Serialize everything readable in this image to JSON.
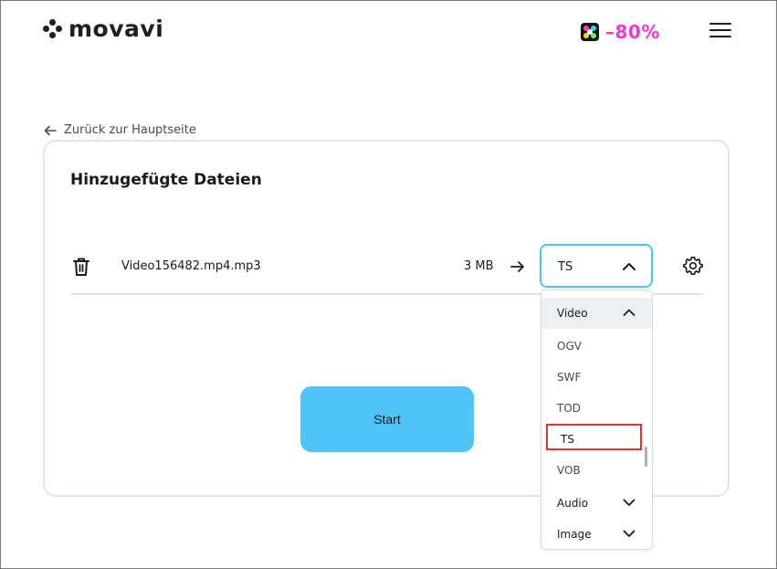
{
  "header": {
    "logo_text": "movavi",
    "promo_text": "–80%",
    "menu_icon": "hamburger-menu-icon"
  },
  "nav": {
    "back_label": "Zurück zur Hauptseite",
    "back_icon": "arrow-left-icon"
  },
  "card": {
    "title": "Hinzugefügte Dateien",
    "file": {
      "name": "Video156482.mp4.mp3",
      "size": "3 MB",
      "format_selected": "TS"
    },
    "start_label": "Start"
  },
  "dropdown": {
    "groups": [
      {
        "label": "Video",
        "expanded": true
      },
      {
        "label": "Audio",
        "expanded": false
      },
      {
        "label": "Image",
        "expanded": false
      }
    ],
    "video_items": [
      "OGV",
      "SWF",
      "TOD",
      "TS",
      "VOB"
    ],
    "selected_item": "TS"
  },
  "colors": {
    "accent": "#4fc4f8",
    "select_border": "#4ec3f7",
    "promo": "#f238d2",
    "highlight": "#e83030"
  }
}
